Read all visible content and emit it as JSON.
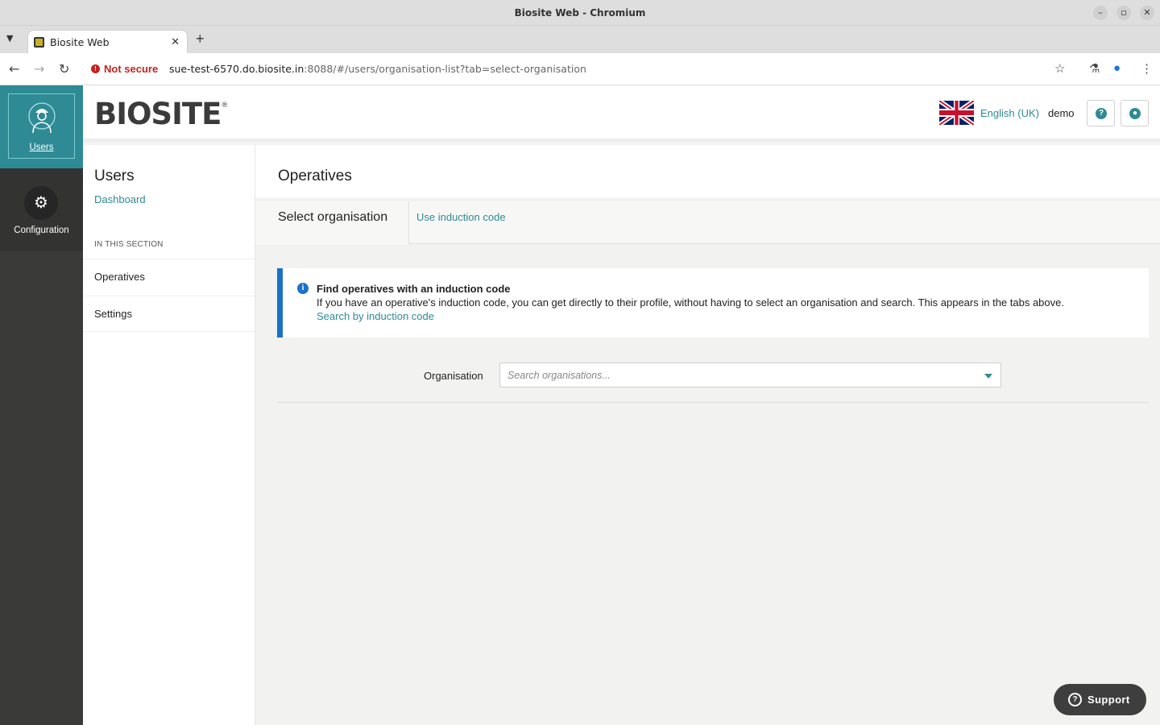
{
  "window": {
    "title": "Biosite Web - Chromium"
  },
  "browser": {
    "tab_title": "Biosite Web",
    "security_label": "Not secure",
    "url_host": "sue-test-6570.do.biosite.in",
    "url_rest": ":8088/#/users/organisation-list?tab=select-organisation"
  },
  "leftnav": {
    "items": [
      {
        "label": "Users",
        "icon": "worker-icon",
        "active": true
      },
      {
        "label": "Configuration",
        "icon": "gear-icon",
        "active": false
      }
    ]
  },
  "header": {
    "logo": "BIOSITE",
    "language": "English (UK)",
    "username": "demo"
  },
  "section": {
    "title": "Users",
    "dashboard_link": "Dashboard",
    "heading": "IN THIS SECTION",
    "items": [
      {
        "label": "Operatives"
      },
      {
        "label": "Settings"
      }
    ]
  },
  "main": {
    "title": "Operatives",
    "tabs": [
      {
        "label": "Select organisation",
        "active": true
      },
      {
        "label": "Use induction code",
        "active": false
      }
    ],
    "info": {
      "title": "Find operatives with an induction code",
      "text": "If you have an operative's induction code, you can get directly to their profile, without having to select an organisation and search. This appears in the tabs above.",
      "link": "Search by induction code"
    },
    "organisation": {
      "label": "Organisation",
      "placeholder": "Search organisations..."
    }
  },
  "support": {
    "label": "Support"
  },
  "colors": {
    "accent": "#2e8b95",
    "info": "#1a72c8",
    "sidebar": "#333332"
  }
}
